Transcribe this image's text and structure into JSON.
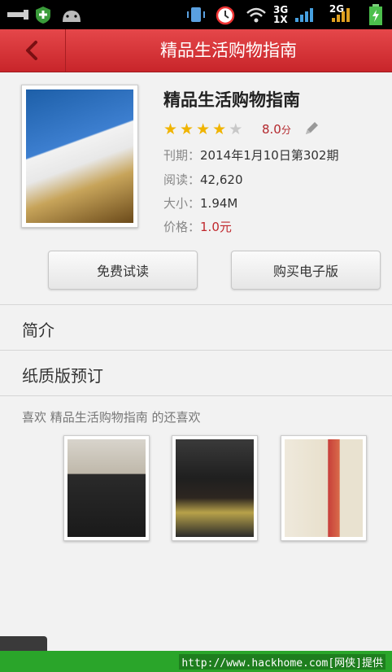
{
  "status_bar": {
    "net1": "3G",
    "net2": "1X",
    "net3": "2G"
  },
  "header": {
    "title": "精品生活购物指南"
  },
  "book": {
    "title": "精品生活购物指南",
    "rating_value": "8.0",
    "rating_unit": "分",
    "stars": 4,
    "stars_max": 5,
    "issue_label": "刊期：",
    "issue_value": "2014年1月10日第302期",
    "reads_label": "阅读：",
    "reads_value": "42,620",
    "size_label": "大小：",
    "size_value": "1.94M",
    "price_label": "价格：",
    "price_value": "1.0元"
  },
  "actions": {
    "free_trial": "免费试读",
    "buy_ebook": "购买电子版"
  },
  "sections": {
    "intro": "简介",
    "paper_order": "纸质版预订"
  },
  "recommend": {
    "heading": "喜欢 精品生活购物指南 的还喜欢"
  },
  "footer": {
    "watermark": "http://www.hackhome.com[网侠]提供"
  },
  "colors": {
    "title_bar": "#d3353a",
    "accent": "#c0282d",
    "star": "#f0b400",
    "footer": "#2aa52a"
  }
}
